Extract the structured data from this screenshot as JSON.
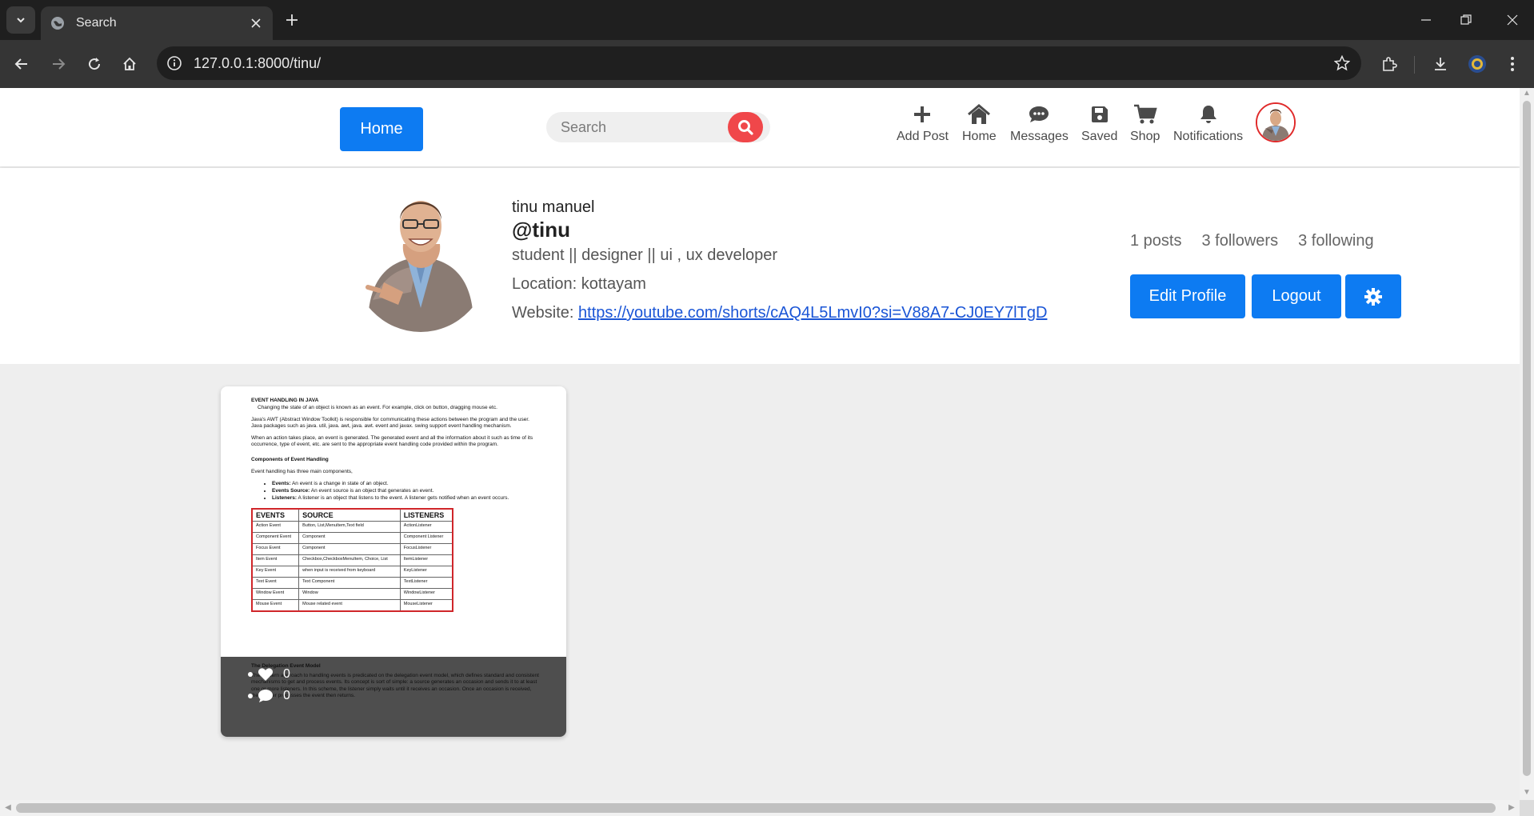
{
  "browser": {
    "tab_title": "Search",
    "url": "127.0.0.1:8000/tinu/"
  },
  "header": {
    "home_button": "Home",
    "search_placeholder": "Search",
    "nav": [
      {
        "label": "Add Post",
        "icon": "plus-icon"
      },
      {
        "label": "Home",
        "icon": "home-icon"
      },
      {
        "label": "Messages",
        "icon": "chat-bubble-icon"
      },
      {
        "label": "Saved",
        "icon": "floppy-disk-icon"
      },
      {
        "label": "Shop",
        "icon": "shopping-cart-icon"
      },
      {
        "label": "Notifications",
        "icon": "bell-icon"
      }
    ],
    "accent_color": "#0d7bf2",
    "search_button_color": "#f0474a"
  },
  "profile": {
    "name": "tinu manuel",
    "handle": "@tinu",
    "bio": "student || designer || ui , ux developer",
    "location_label": "Location:",
    "location": "kottayam",
    "website_label": "Website:",
    "website": "https://youtube.com/shorts/cAQ4L5LmvI0?si=V88A7-CJ0EY7lTgD",
    "stats": {
      "posts": "1 posts",
      "followers": "3 followers",
      "following": "3 following"
    },
    "buttons": {
      "edit": "Edit Profile",
      "logout": "Logout"
    }
  },
  "post": {
    "likes": "0",
    "comments": "0",
    "doc": {
      "title": "EVENT HANDLING IN JAVA",
      "p1": "Changing the state of an object is known as an event. For example, click on button, dragging mouse etc.",
      "p2": "Java's AWT (Abstract Window Toolkit) is responsible for communicating these actions between the program and the user. Java packages such as java. util, java. awt, java. awt. event and javax. swing support event handling mechanism.",
      "p3": "When an action takes place, an event is generated. The generated event and all the information about it such as time of its occurrence, type of event, etc. are sent to the appropriate event handling code provided within the program.",
      "h2": "Components of Event Handling",
      "p4": "Event handling has three main components,",
      "bullets": [
        {
          "term": "Events:",
          "text": "An event is a change in state of an object."
        },
        {
          "term": "Events Source:",
          "text": "An event source is an object that generates an event."
        },
        {
          "term": "Listeners:",
          "text": "A listener is an object that listens to the event. A listener gets notified when an event occurs."
        }
      ],
      "table_headers": [
        "EVENTS",
        "SOURCE",
        "LISTENERS"
      ],
      "table_rows": [
        [
          "Action Event",
          "Button, List,MenuItem,Text field",
          "ActionListener"
        ],
        [
          "Component Event",
          "Component",
          "Component Listener"
        ],
        [
          "Focus Event",
          "Component",
          "FocusListener"
        ],
        [
          "Item Event",
          "Checkbox,CheckboxMenuItem, Choice, List",
          "ItemListener"
        ],
        [
          "Key Event",
          "when input is received from keyboard",
          "KeyListener"
        ],
        [
          "Text Event",
          "Text Component",
          "TextListener"
        ],
        [
          "Window Event",
          "Window",
          "WindowListener"
        ],
        [
          "Mouse Event",
          "Mouse related event",
          "MouseListener"
        ]
      ],
      "h3": "The Delegation Event Model",
      "p5": "The modern approach to handling events is predicated on the delegation event model, which defines standard and consistent mechanisms to get and process events. Its concept is sort of simple: a source generates an occasion and sends it to at least one or more listeners. In this scheme, the listener simply waits until it receives an occasion. Once an occasion is received, the listener processes the event then returns."
    }
  }
}
